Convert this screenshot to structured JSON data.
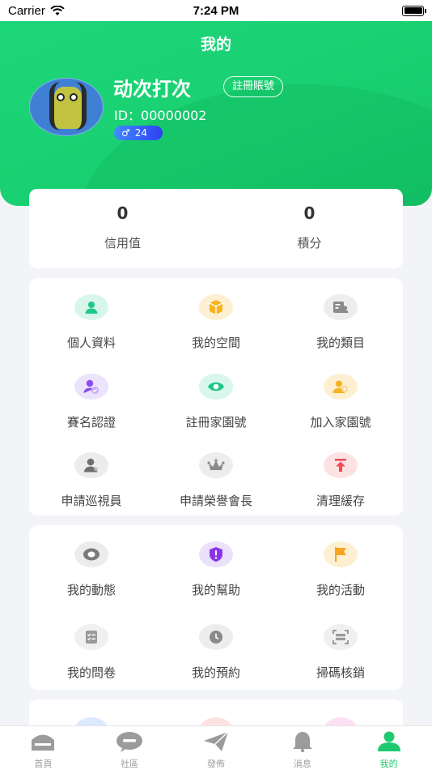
{
  "status_bar": {
    "carrier": "Carrier",
    "time": "7:24 PM"
  },
  "header": {
    "title": "我的",
    "user_name": "动次打次",
    "register_label": "註冊賬號",
    "user_id": "ID：00000002",
    "gender_symbol": "♂",
    "age": "24"
  },
  "stats": [
    {
      "value": "0",
      "label": "信用值"
    },
    {
      "value": "0",
      "label": "積分"
    }
  ],
  "menu_group_1": [
    {
      "label": "個人資料",
      "icon": "profile-icon",
      "color": "#1cc98a",
      "bg": "#d9f6ec"
    },
    {
      "label": "我的空間",
      "icon": "box-icon",
      "color": "#f7b320",
      "bg": "#fdf0d2"
    },
    {
      "label": "我的類目",
      "icon": "id-card-icon",
      "color": "#8a8a8a",
      "bg": "#ededed"
    },
    {
      "label": "賽名認證",
      "icon": "verified-user-icon",
      "color": "#8b4cf0",
      "bg": "#ece3fd"
    },
    {
      "label": "註冊家園號",
      "icon": "eye-icon",
      "color": "#1cc98a",
      "bg": "#d9f6ec"
    },
    {
      "label": "加入家園號",
      "icon": "add-user-icon",
      "color": "#f7b320",
      "bg": "#fdf0d2"
    },
    {
      "label": "申請巡視員",
      "icon": "inspector-icon",
      "color": "#6f6f6f",
      "bg": "#ececec"
    },
    {
      "label": "申請榮譽會長",
      "icon": "crown-icon",
      "color": "#8a8a8a",
      "bg": "#ededed"
    },
    {
      "label": "清理緩存",
      "icon": "clear-cache-icon",
      "color": "#f04a55",
      "bg": "#fde2e4"
    }
  ],
  "menu_group_2": [
    {
      "label": "我的動態",
      "icon": "feed-icon",
      "color": "#7a7a7a",
      "bg": "#ececec"
    },
    {
      "label": "我的幫助",
      "icon": "shield-icon",
      "color": "#8b35e6",
      "bg": "#ece1fb"
    },
    {
      "label": "我的活動",
      "icon": "flag-icon",
      "color": "#f7a520",
      "bg": "#fdf0d2"
    },
    {
      "label": "我的問卷",
      "icon": "checklist-icon",
      "color": "#9a9a9a",
      "bg": "#f0f0f0"
    },
    {
      "label": "我的預約",
      "icon": "clock-icon",
      "color": "#8a8a8a",
      "bg": "#ededed"
    },
    {
      "label": "掃碼核銷",
      "icon": "scan-icon",
      "color": "#9a9a9a",
      "bg": "#f0f0f0"
    }
  ],
  "tabs": [
    {
      "label": "首頁",
      "icon": "home-icon"
    },
    {
      "label": "社區",
      "icon": "chat-icon"
    },
    {
      "label": "發佈",
      "icon": "send-icon"
    },
    {
      "label": "消息",
      "icon": "bell-icon"
    },
    {
      "label": "我的",
      "icon": "user-icon",
      "active": true
    }
  ]
}
